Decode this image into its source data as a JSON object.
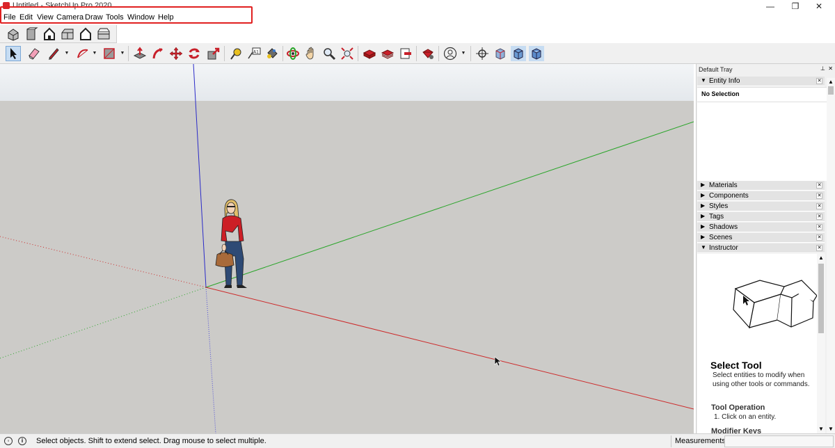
{
  "window": {
    "title": "Untitled - SketchUp Pro 2020",
    "minimize": "—",
    "maximize": "❐",
    "close": "✕"
  },
  "menu": {
    "items": [
      "File",
      "Edit",
      "View",
      "Camera",
      "Draw",
      "Tools",
      "Window",
      "Help"
    ],
    "highlight_color": "#e02020"
  },
  "toolbar_views": {
    "icons": [
      "iso-view-icon",
      "top-view-icon",
      "front-view-icon",
      "right-view-icon",
      "back-view-icon",
      "left-view-icon"
    ]
  },
  "toolbar_main": {
    "icons": [
      "select-icon",
      "eraser-icon",
      "pencil-icon",
      "arc-icon",
      "rectangle-icon",
      "push-pull-icon",
      "follow-me-icon",
      "move-icon",
      "rotate-icon",
      "scale-icon",
      "tape-measure-icon",
      "text-icon",
      "paint-bucket-icon",
      "orbit-icon",
      "pan-icon",
      "zoom-icon",
      "zoom-extents-icon",
      "warehouse-icon",
      "extension-warehouse-icon",
      "send-to-layout-icon",
      "extension-manager-icon",
      "account-icon",
      "position-camera-icon",
      "xray-icon",
      "back-edges-icon",
      "wireframe-icon"
    ],
    "text_tool_glyph": "A1"
  },
  "tray": {
    "title": "Default Tray",
    "pin": "⊥",
    "close": "✕",
    "entity_info": {
      "label": "Entity Info",
      "value": "No Selection",
      "expanded": true
    },
    "panels": [
      {
        "label": "Materials",
        "expanded": false
      },
      {
        "label": "Components",
        "expanded": false
      },
      {
        "label": "Styles",
        "expanded": false
      },
      {
        "label": "Tags",
        "expanded": false
      },
      {
        "label": "Shadows",
        "expanded": false
      },
      {
        "label": "Scenes",
        "expanded": false
      },
      {
        "label": "Instructor",
        "expanded": true
      }
    ],
    "instructor": {
      "title": "Select Tool",
      "description": "Select entities to modify when using other tools or commands.",
      "operation_title": "Tool Operation",
      "operation_step": "1. Click on an entity.",
      "modifier_title": "Modifier Keys"
    }
  },
  "status": {
    "text": "Select objects. Shift to extend select. Drag mouse to select multiple.",
    "measurements_label": "Measurements",
    "measurements_value": ""
  },
  "colors": {
    "axis_red": "#cc2a2a",
    "axis_green": "#2aa52a",
    "axis_blue": "#2a2ac8",
    "ground": "#cccbc8",
    "sky_top": "#f3f5f7"
  }
}
